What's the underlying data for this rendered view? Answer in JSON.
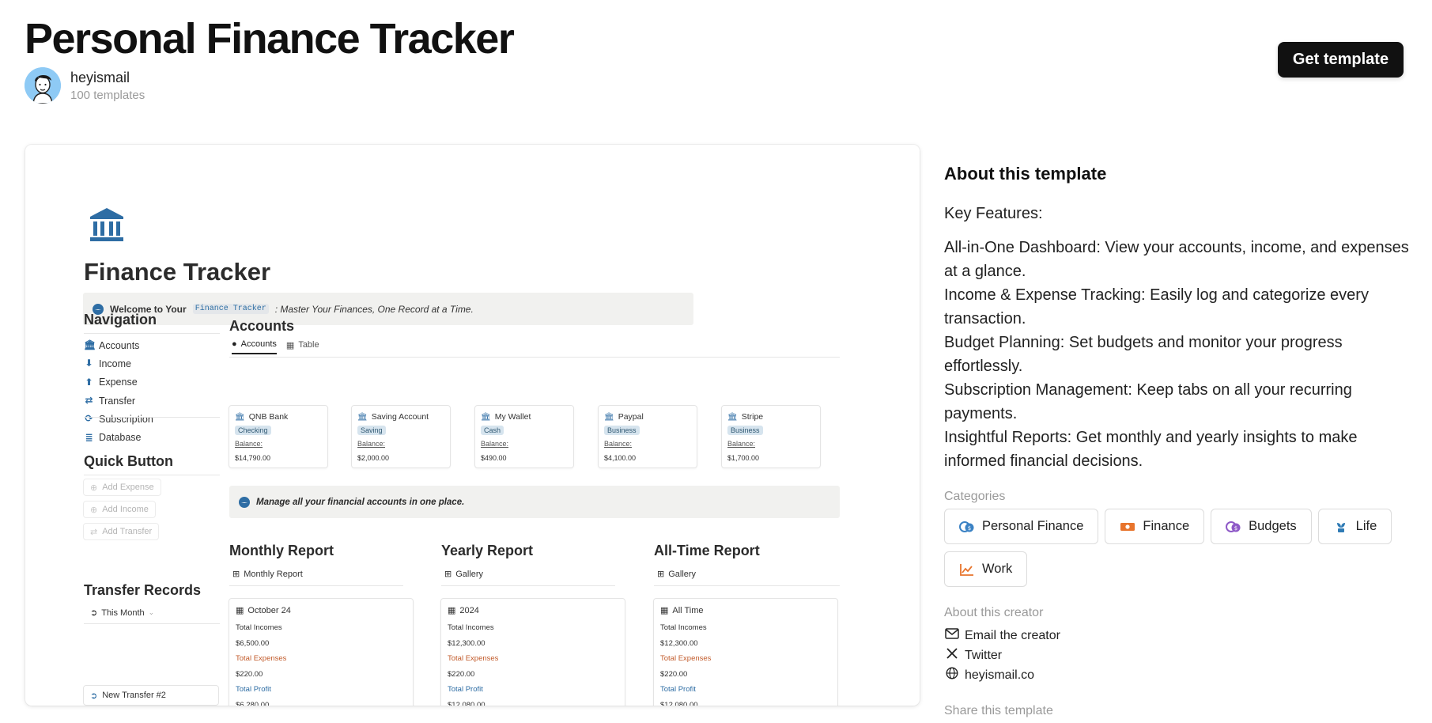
{
  "header": {
    "title": "Personal Finance Tracker",
    "author_name": "heyismail",
    "author_meta": "100 templates",
    "cta_label": "Get template"
  },
  "preview": {
    "title": "Finance Tracker",
    "welcome": {
      "prefix": "Welcome to Your",
      "code": "Finance Tracker",
      "suffix": ": Master Your Finances, One Record at a Time."
    },
    "navigation": {
      "heading": "Navigation",
      "items": [
        {
          "label": "Accounts",
          "icon": "bank-icon"
        },
        {
          "label": "Income",
          "icon": "arrow-down-circle-icon"
        },
        {
          "label": "Expense",
          "icon": "arrow-up-circle-icon"
        },
        {
          "label": "Transfer",
          "icon": "transfer-icon"
        },
        {
          "label": "Subscription",
          "icon": "repeat-icon"
        },
        {
          "label": "Database",
          "icon": "database-icon"
        }
      ]
    },
    "quick_button": {
      "heading": "Quick Button",
      "items": [
        "Add Expense",
        "Add Income",
        "Add Transfer"
      ]
    },
    "transfer_records": {
      "heading": "Transfer Records",
      "filter": "This Month",
      "items": [
        "New Transfer #2"
      ]
    },
    "accounts": {
      "heading": "Accounts",
      "tabs": [
        "Accounts",
        "Table"
      ],
      "balance_label": "Balance:",
      "cards": [
        {
          "name": "QNB Bank",
          "tag": "Checking",
          "balance": "$14,790.00"
        },
        {
          "name": "Saving Account",
          "tag": "Saving",
          "balance": "$2,000.00"
        },
        {
          "name": "My Wallet",
          "tag": "Cash",
          "balance": "$490.00"
        },
        {
          "name": "Paypal",
          "tag": "Business",
          "balance": "$4,100.00"
        },
        {
          "name": "Stripe",
          "tag": "Business",
          "balance": "$1,700.00"
        }
      ],
      "callout": "Manage all your financial accounts in one place."
    },
    "reports": [
      {
        "title": "Monthly Report",
        "view": "Monthly Report",
        "card": "October 24",
        "incomes": "$6,500.00",
        "expenses": "$220.00",
        "profit": "$6,280.00"
      },
      {
        "title": "Yearly Report",
        "view": "Gallery",
        "card": "2024",
        "incomes": "$12,300.00",
        "expenses": "$220.00",
        "profit": "$12,080.00"
      },
      {
        "title": "All-Time Report",
        "view": "Gallery",
        "card": "All Time",
        "incomes": "$12,300.00",
        "expenses": "$220.00",
        "profit": "$12,080.00"
      }
    ],
    "report_labels": {
      "incomes": "Total Incomes",
      "expenses": "Total Expenses",
      "profit": "Total Profit"
    }
  },
  "about": {
    "heading": "About this template",
    "key_features": "Key Features:",
    "features": [
      "All-in-One Dashboard: View your accounts, income, and expenses at a glance.",
      "Income & Expense Tracking: Easily log and categorize every transaction.",
      "Budget Planning: Set budgets and monitor your progress effortlessly.",
      "Subscription Management: Keep tabs on all your recurring payments.",
      "Insightful Reports: Get monthly and yearly insights to make informed financial decisions."
    ]
  },
  "categories": {
    "heading": "Categories",
    "items": [
      {
        "label": "Personal Finance",
        "icon": "coins-icon",
        "color": "#3b82c4"
      },
      {
        "label": "Finance",
        "icon": "banknote-icon",
        "color": "#e8742c"
      },
      {
        "label": "Budgets",
        "icon": "coins-icon",
        "color": "#8e59c7"
      },
      {
        "label": "Life",
        "icon": "plant-icon",
        "color": "#2f7bb5"
      },
      {
        "label": "Work",
        "icon": "chart-up-icon",
        "color": "#e8742c"
      }
    ]
  },
  "creator": {
    "heading": "About this creator",
    "links": [
      {
        "label": "Email the creator",
        "icon": "mail-icon"
      },
      {
        "label": "Twitter",
        "icon": "x-logo-icon"
      },
      {
        "label": "heyismail.co",
        "icon": "globe-icon"
      }
    ]
  },
  "share": {
    "heading": "Share this template"
  }
}
